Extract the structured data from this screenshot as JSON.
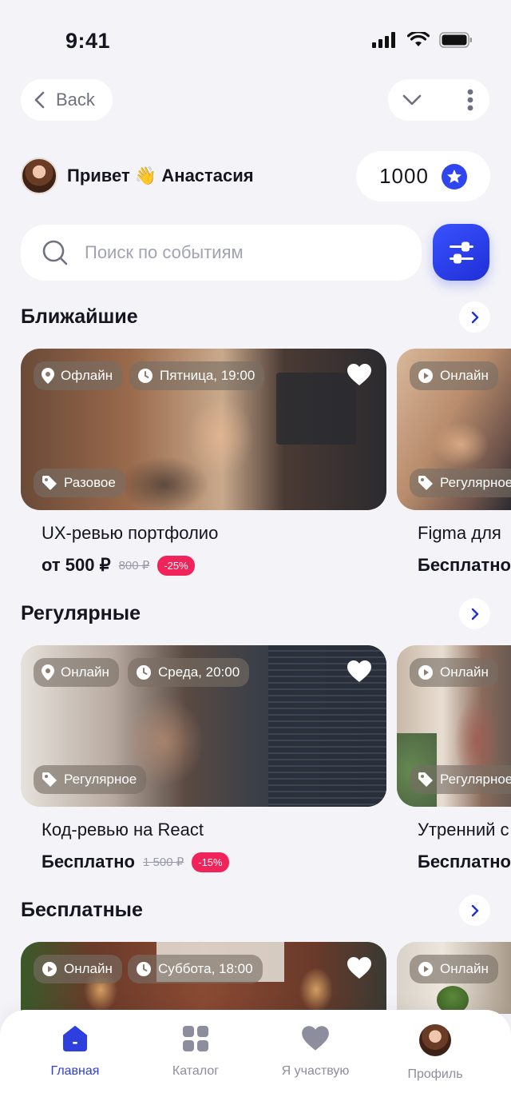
{
  "status_bar": {
    "time": "9:41"
  },
  "nav": {
    "back_label": "Back"
  },
  "greeting": {
    "hello": "Привет",
    "emoji": "👋",
    "name": "Анастасия"
  },
  "points": {
    "value": "1000"
  },
  "search": {
    "placeholder": "Поиск по событиям"
  },
  "sections": [
    {
      "title": "Ближайшие",
      "cards": [
        {
          "format": "Офлайн",
          "datetime": "Пятница, 19:00",
          "type": "Разовое",
          "title": "UX-ревью портфолио",
          "price": "от 500 ₽",
          "old_price": "800 ₽",
          "discount": "-25%"
        },
        {
          "format": "Онлайн",
          "type": "Регулярное",
          "title": "Figma для",
          "price": "Бесплатно"
        }
      ]
    },
    {
      "title": "Регулярные",
      "cards": [
        {
          "format": "Онлайн",
          "datetime": "Среда, 20:00",
          "type": "Регулярное",
          "title": "Код-ревью на React",
          "price": "Бесплатно",
          "old_price": "1 500 ₽",
          "discount": "-15%"
        },
        {
          "format": "Онлайн",
          "type": "Регулярное",
          "title": "Утренний с",
          "price": "Бесплатно"
        }
      ]
    },
    {
      "title": "Бесплатные",
      "cards": [
        {
          "format": "Онлайн",
          "datetime": "Суббота, 18:00"
        },
        {
          "format": "Онлайн"
        }
      ]
    }
  ],
  "tabbar": [
    {
      "label": "Главная",
      "icon": "home-icon",
      "active": true
    },
    {
      "label": "Каталог",
      "icon": "grid-icon"
    },
    {
      "label": "Я участвую",
      "icon": "heart-icon"
    },
    {
      "label": "Профиль",
      "icon": "avatar"
    }
  ],
  "colors": {
    "accent": "#2e3fe0",
    "discount": "#f0235a",
    "background": "#f3f3f8"
  }
}
